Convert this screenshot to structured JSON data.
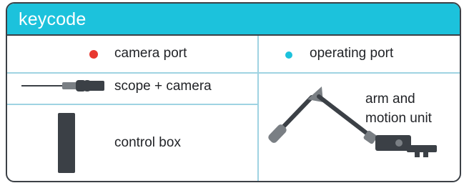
{
  "header": {
    "title": "keycode",
    "background_color": "#1cc2dc"
  },
  "legend": {
    "camera_port": {
      "label": "camera port",
      "color": "#e8372f",
      "icon": "red-dot-icon"
    },
    "operating_port": {
      "label": "operating port",
      "color": "#1cc2dc",
      "icon": "cyan-dot-icon"
    },
    "scope_camera": {
      "label": "scope + camera",
      "icon": "scope-camera-icon"
    },
    "control_box": {
      "label": "control box",
      "icon": "control-box-icon"
    },
    "arm_motion_unit": {
      "label_line1": "arm and",
      "label_line2": "motion unit",
      "icon": "robotic-arm-icon"
    }
  },
  "colors": {
    "border": "#3b4046",
    "grid": "#9fd3e2",
    "device_dark": "#3b4046",
    "device_gray": "#7a7f84"
  }
}
